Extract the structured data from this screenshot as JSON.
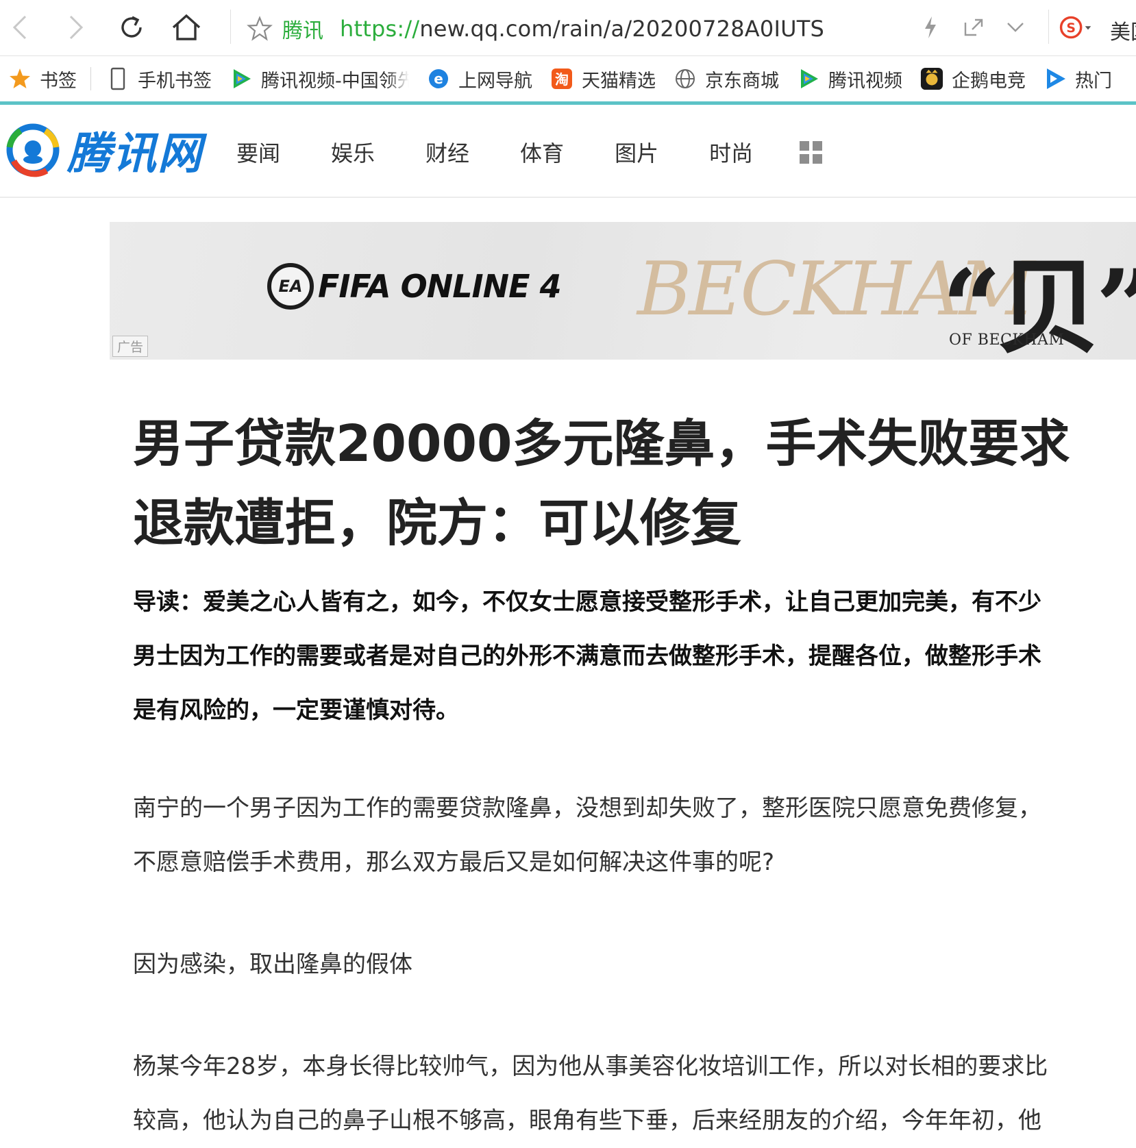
{
  "browser": {
    "site_name": "腾讯",
    "url_scheme": "https://",
    "url_rest": "new.qq.com/rain/a/20200728A0IUTS",
    "profile_label": "美国"
  },
  "bookmarks": {
    "items": [
      {
        "label": "书签",
        "icon": "star-icon"
      },
      {
        "label": "手机书签",
        "icon": "phone-icon"
      },
      {
        "label": "腾讯视频-中国领先",
        "icon": "tencent-video-icon"
      },
      {
        "label": "上网导航",
        "icon": "ie-icon"
      },
      {
        "label": "天猫精选",
        "icon": "taobao-icon"
      },
      {
        "label": "京东商城",
        "icon": "globe-icon"
      },
      {
        "label": "腾讯视频",
        "icon": "tencent-video-icon"
      },
      {
        "label": "企鹅电竞",
        "icon": "esports-icon"
      },
      {
        "label": "热门",
        "icon": "play-icon"
      }
    ]
  },
  "site": {
    "logo_text": "腾讯网",
    "nav": [
      "要闻",
      "娱乐",
      "财经",
      "体育",
      "图片",
      "时尚"
    ]
  },
  "ad": {
    "tag": "广告",
    "fifa": "FIFA ONLINE 4",
    "ea": "EA",
    "script": "BECKHAM",
    "big_text": "“贝”影",
    "of_beckham": "OF BECKHAM"
  },
  "article": {
    "title_line1": "男子贷款20000多元隆鼻，手术失败要求",
    "title_line2": "退款遭拒，院方：可以修复",
    "lead_line1": "导读：爱美之心人皆有之，如今，不仅女士愿意接受整形手术，让自己更加完美，有不少",
    "lead_line2": "男士因为工作的需要或者是对自己的外形不满意而去做整形手术，提醒各位，做整形手术",
    "lead_line3": "是有风险的，一定要谨慎对待。",
    "p1_line1": "南宁的一个男子因为工作的需要贷款隆鼻，没想到却失败了，整形医院只愿意免费修复，",
    "p1_line2": "不愿意赔偿手术费用，那么双方最后又是如何解决这件事的呢?",
    "subhead": "因为感染，取出隆鼻的假体",
    "p2_line1": "杨某今年28岁，本身长得比较帅气，因为他从事美容化妆培训工作，所以对长相的要求比",
    "p2_line2": "较高，他认为自己的鼻子山根不够高，眼角有些下垂，后来经朋友的介绍，今年年初，他"
  },
  "colors": {
    "url_green": "#2bad3c",
    "accent_teal": "#5cc3c7",
    "logo_blue": "#1479d7"
  }
}
